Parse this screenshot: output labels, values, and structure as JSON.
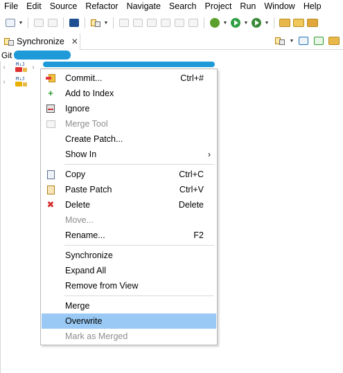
{
  "menubar": {
    "items": [
      "File",
      "Edit",
      "Source",
      "Refactor",
      "Navigate",
      "Search",
      "Project",
      "Run",
      "Window",
      "Help"
    ]
  },
  "toolbar": {
    "icons": [
      "new-icon",
      "save-icon",
      "save-all-icon",
      "terminal-icon",
      "synchronize-icon",
      "pin-icon",
      "refactor-icon",
      "link-icon",
      "compare-icon",
      "template-icon",
      "paragraph-icon",
      "debug-icon",
      "run-icon",
      "external-tools-icon",
      "open-folder-icon",
      "open-type-icon",
      "search-icon"
    ]
  },
  "view": {
    "tab_label": "Synchronize",
    "repo_prefix": "Git"
  },
  "tree": {
    "rows": [
      {
        "label_top": "M↓J",
        "status": "conflict"
      },
      {
        "label_top": "M↓J",
        "status": "warning"
      }
    ]
  },
  "context_menu": {
    "items": [
      {
        "label": "Commit...",
        "shortcut": "Ctrl+#",
        "icon": "commit-icon",
        "enabled": true
      },
      {
        "label": "Add to Index",
        "shortcut": "",
        "icon": "add-icon",
        "enabled": true
      },
      {
        "label": "Ignore",
        "shortcut": "",
        "icon": "ignore-icon",
        "enabled": true
      },
      {
        "label": "Merge Tool",
        "shortcut": "",
        "icon": "merge-tool-icon",
        "enabled": false
      },
      {
        "label": "Create Patch...",
        "shortcut": "",
        "icon": "",
        "enabled": true
      },
      {
        "label": "Show In",
        "shortcut": "",
        "icon": "",
        "enabled": true,
        "submenu": true
      },
      {
        "label": "Copy",
        "shortcut": "Ctrl+C",
        "icon": "copy-icon",
        "enabled": true
      },
      {
        "label": "Paste Patch",
        "shortcut": "Ctrl+V",
        "icon": "paste-icon",
        "enabled": true
      },
      {
        "label": "Delete",
        "shortcut": "Delete",
        "icon": "delete-icon",
        "enabled": true
      },
      {
        "label": "Move...",
        "shortcut": "",
        "icon": "",
        "enabled": false
      },
      {
        "label": "Rename...",
        "shortcut": "F2",
        "icon": "",
        "enabled": true
      },
      {
        "label": "Synchronize",
        "shortcut": "",
        "icon": "",
        "enabled": true
      },
      {
        "label": "Expand All",
        "shortcut": "",
        "icon": "",
        "enabled": true
      },
      {
        "label": "Remove from View",
        "shortcut": "",
        "icon": "",
        "enabled": true
      },
      {
        "label": "Merge",
        "shortcut": "",
        "icon": "",
        "enabled": true
      },
      {
        "label": "Overwrite",
        "shortcut": "",
        "icon": "",
        "enabled": true,
        "highlighted": true
      },
      {
        "label": "Mark as Merged",
        "shortcut": "",
        "icon": "",
        "enabled": false
      }
    ],
    "submenu_arrow": "›"
  },
  "colors": {
    "highlight": "#99c9f4",
    "redaction": "#1f9ad9",
    "disabled_text": "#8d8d8d"
  }
}
